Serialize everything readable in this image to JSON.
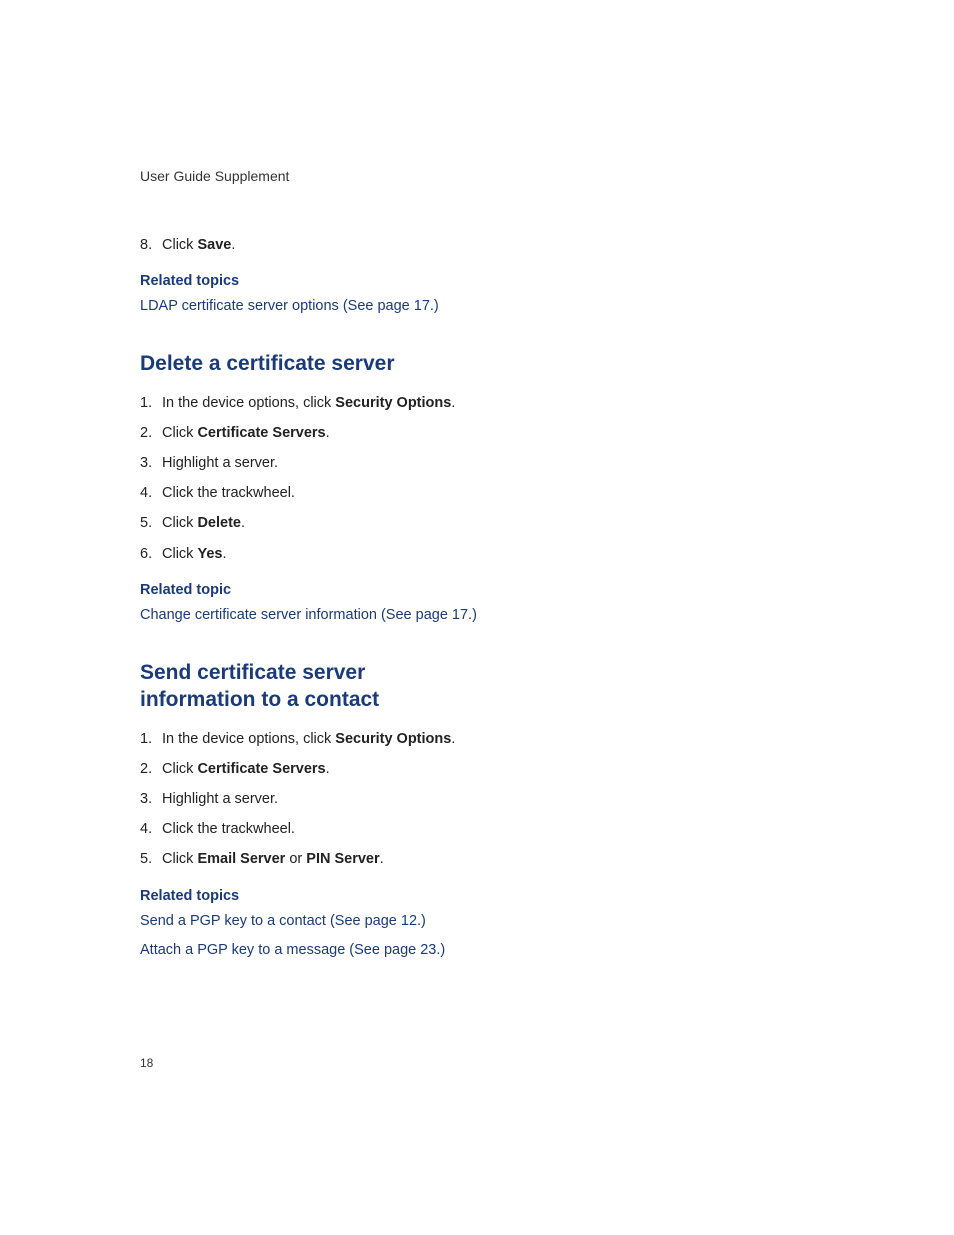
{
  "header": "User Guide Supplement",
  "top_list": {
    "num": "8.",
    "prefix": "Click ",
    "bold": "Save",
    "suffix": "."
  },
  "related1": {
    "heading": "Related topics",
    "link": "LDAP certificate server options (See page 17.)"
  },
  "section1": {
    "heading": "Delete a certificate server",
    "steps": [
      {
        "num": "1.",
        "parts": [
          {
            "t": "In the device options, click "
          },
          {
            "t": "Security Options",
            "b": true
          },
          {
            "t": "."
          }
        ]
      },
      {
        "num": "2.",
        "parts": [
          {
            "t": "Click "
          },
          {
            "t": "Certificate Servers",
            "b": true
          },
          {
            "t": "."
          }
        ]
      },
      {
        "num": "3.",
        "parts": [
          {
            "t": "Highlight a server."
          }
        ]
      },
      {
        "num": "4.",
        "parts": [
          {
            "t": "Click the trackwheel."
          }
        ]
      },
      {
        "num": "5.",
        "parts": [
          {
            "t": "Click "
          },
          {
            "t": "Delete",
            "b": true
          },
          {
            "t": "."
          }
        ]
      },
      {
        "num": "6.",
        "parts": [
          {
            "t": "Click "
          },
          {
            "t": "Yes",
            "b": true
          },
          {
            "t": "."
          }
        ]
      }
    ],
    "related": {
      "heading": "Related topic",
      "links": [
        "Change certificate server information (See page 17.)"
      ]
    }
  },
  "section2": {
    "heading": "Send certificate server information to a contact",
    "steps": [
      {
        "num": "1.",
        "parts": [
          {
            "t": "In the device options, click "
          },
          {
            "t": "Security Options",
            "b": true
          },
          {
            "t": "."
          }
        ]
      },
      {
        "num": "2.",
        "parts": [
          {
            "t": "Click "
          },
          {
            "t": "Certificate Servers",
            "b": true
          },
          {
            "t": "."
          }
        ]
      },
      {
        "num": "3.",
        "parts": [
          {
            "t": "Highlight a server."
          }
        ]
      },
      {
        "num": "4.",
        "parts": [
          {
            "t": "Click the trackwheel."
          }
        ]
      },
      {
        "num": "5.",
        "parts": [
          {
            "t": "Click "
          },
          {
            "t": "Email Server",
            "b": true
          },
          {
            "t": " or "
          },
          {
            "t": "PIN Server",
            "b": true
          },
          {
            "t": "."
          }
        ]
      }
    ],
    "related": {
      "heading": "Related topics",
      "links": [
        "Send a PGP key to a contact (See page 12.)",
        "Attach a PGP key to a message (See page 23.)"
      ]
    }
  },
  "page_number": "18"
}
